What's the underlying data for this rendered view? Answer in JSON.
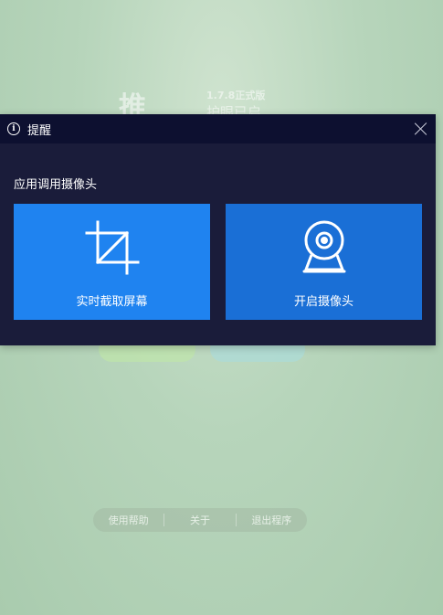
{
  "background_app": {
    "logo_text": "推图",
    "version": "1.7.8正式版",
    "subtitle": "护眼已启",
    "buttons": [
      {
        "label": ""
      },
      {
        "label": ""
      }
    ],
    "footer": {
      "help": "使用帮助",
      "about": "关于",
      "exit": "退出程序"
    }
  },
  "dialog": {
    "title": "提醒",
    "prompt": "应用调用摄像头",
    "options": [
      {
        "label": "实时截取屏幕",
        "icon": "crop-icon"
      },
      {
        "label": "开启摄像头",
        "icon": "webcam-icon"
      }
    ],
    "colors": {
      "titlebar": "#0d1030",
      "body": "#1a1c3a",
      "card_left": "#1f83f0",
      "card_right": "#1a6fd6"
    }
  }
}
